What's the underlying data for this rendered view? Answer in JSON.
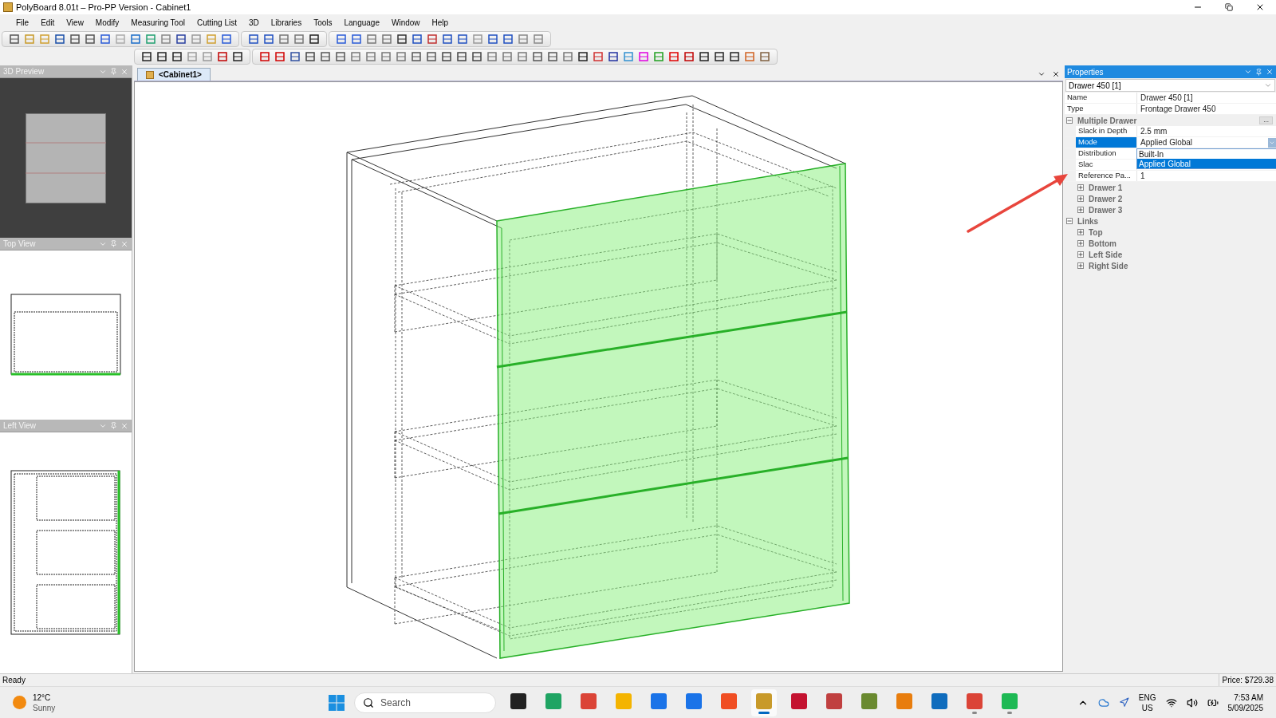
{
  "window": {
    "title": "PolyBoard 8.01t – Pro-PP Version - Cabinet1"
  },
  "menu": [
    "File",
    "Edit",
    "View",
    "Modify",
    "Measuring Tool",
    "Cutting List",
    "3D",
    "Libraries",
    "Tools",
    "Language",
    "Window",
    "Help"
  ],
  "panels": [
    {
      "title": "3D Preview"
    },
    {
      "title": "Top View"
    },
    {
      "title": "Left View"
    }
  ],
  "document_tab": {
    "label": "<Cabinet1>",
    "selected": true
  },
  "properties": {
    "title": "Properties",
    "object": "Drawer 450 [1]",
    "rows": [
      {
        "kind": "field",
        "label": "Name",
        "value": "Drawer 450 [1]",
        "selected": false
      },
      {
        "kind": "field",
        "label": "Type",
        "value": "Frontage Drawer 450",
        "selected": false
      },
      {
        "kind": "group",
        "label": "Multiple Drawer",
        "expanded": true,
        "more": "...",
        "children": [
          {
            "kind": "field",
            "label": "Slack in Depth",
            "value": "2.5 mm",
            "selected": false
          },
          {
            "kind": "field",
            "label": "Mode",
            "value": "Applied Global",
            "selected": true,
            "options": [
              {
                "label": "Built-In",
                "selected": false
              },
              {
                "label": "Applied Global",
                "selected": true
              }
            ]
          },
          {
            "kind": "field",
            "label": "Distribution",
            "selected": false
          },
          {
            "kind": "field",
            "label": "Slac",
            "selected": false
          },
          {
            "kind": "field",
            "label": "Reference Pa...",
            "value": "1",
            "selected": false
          },
          {
            "kind": "group",
            "label": "Drawer 1",
            "expanded": false
          },
          {
            "kind": "group",
            "label": "Drawer 2",
            "expanded": false
          },
          {
            "kind": "group",
            "label": "Drawer 3",
            "expanded": false
          }
        ]
      },
      {
        "kind": "group",
        "label": "Links",
        "expanded": true,
        "children": [
          {
            "kind": "group",
            "label": "Top",
            "expanded": false
          },
          {
            "kind": "group",
            "label": "Bottom",
            "expanded": false
          },
          {
            "kind": "group",
            "label": "Left Side",
            "expanded": false
          },
          {
            "kind": "group",
            "label": "Right Side",
            "expanded": false
          }
        ]
      }
    ]
  },
  "status_bar": {
    "left": "Ready",
    "right": "Price: $729.38"
  },
  "taskbar": {
    "weather": {
      "temp": "12°C",
      "condition": "Sunny"
    },
    "search": {
      "placeholder": "Search"
    },
    "apps": [
      {
        "selected": false,
        "running": false
      },
      {
        "selected": false,
        "running": false
      },
      {
        "selected": false,
        "running": false
      },
      {
        "selected": false,
        "running": false
      },
      {
        "selected": false,
        "running": false
      },
      {
        "selected": false,
        "running": false
      },
      {
        "selected": false,
        "running": false
      },
      {
        "selected": true,
        "running": true
      },
      {
        "selected": false,
        "running": false
      },
      {
        "selected": false,
        "running": false
      },
      {
        "selected": false,
        "running": false
      },
      {
        "selected": false,
        "running": false
      },
      {
        "selected": false,
        "running": false
      },
      {
        "selected": false,
        "running": true
      },
      {
        "selected": false,
        "running": true
      }
    ],
    "language": [
      "ENG",
      "US"
    ],
    "time": "7:53 AM",
    "date": "5/09/2025"
  }
}
